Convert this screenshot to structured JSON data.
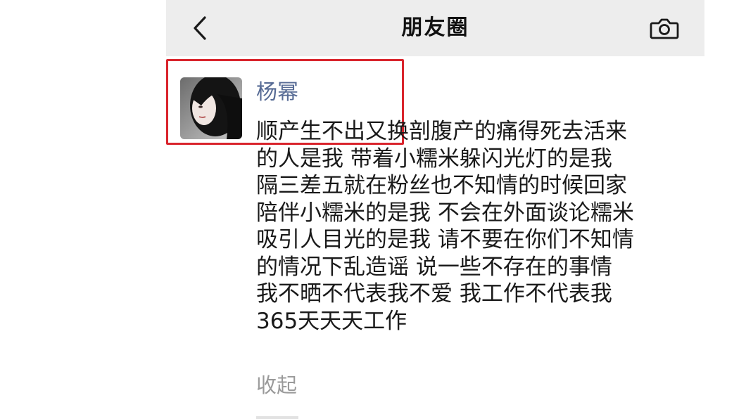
{
  "navbar": {
    "back_icon": "chevron-left-icon",
    "title": "朋友圈",
    "camera_icon": "camera-icon",
    "background_color": "#ededed"
  },
  "post": {
    "author": "杨幂",
    "avatar_icon": "avatar-photo",
    "lines": [
      "顺产生不出又换剖腹产的痛得死去活来",
      "的人是我 带着小糯米躲闪光灯的是我",
      "隔三差五就在粉丝也不知情的时候回家",
      "陪伴小糯米的是我 不会在外面谈论糯米",
      "吸引人目光的是我 请不要在你们不知情",
      "的情况下乱造谣 说一些不存在的事情",
      "我不晒不代表我不爱 我工作不代表我",
      "365天天天工作"
    ],
    "collapse_label": "收起",
    "author_color": "#576b95",
    "highlight_color": "#d9242c"
  }
}
